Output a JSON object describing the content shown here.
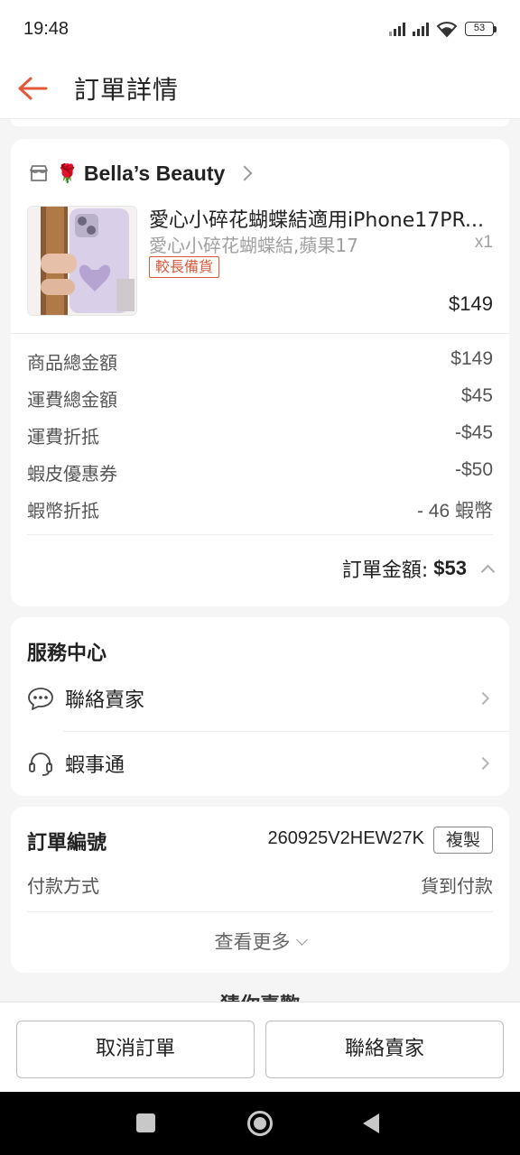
{
  "status_bar": {
    "time": "19:48",
    "battery": "53"
  },
  "header": {
    "title": "訂單詳情"
  },
  "shop": {
    "name": "Bella’s Beauty",
    "emoji": "🌹"
  },
  "product": {
    "title": "愛心小碎花蝴蝶結適用iPhone17PR...",
    "variant": "愛心小碎花蝴蝶結,蘋果17",
    "quantity": "x1",
    "tag": "較長備貨",
    "price": "$149"
  },
  "summary": {
    "rows": [
      {
        "label": "商品總金額",
        "value": "$149"
      },
      {
        "label": "運費總金額",
        "value": "$45"
      },
      {
        "label": "運費折抵",
        "value": "-$45"
      },
      {
        "label": "蝦皮優惠券",
        "value": "-$50"
      },
      {
        "label": "蝦幣折抵",
        "value": "- 46 蝦幣"
      }
    ],
    "total_label": "訂單金額:",
    "total_value": "$53"
  },
  "service": {
    "title": "服務中心",
    "items": [
      {
        "label": "聯絡賣家",
        "icon": "chat-icon"
      },
      {
        "label": "蝦事通",
        "icon": "headset-icon"
      }
    ]
  },
  "order_info": {
    "id_label": "訂單編號",
    "id_value": "260925V2HEW27K",
    "copy_label": "複製",
    "payment_label": "付款方式",
    "payment_value": "貨到付款",
    "more_label": "查看更多"
  },
  "recommend_label": "猜你喜歡",
  "bottom_bar": {
    "cancel_label": "取消訂單",
    "contact_label": "聯絡賣家"
  },
  "colors": {
    "accent": "#e05a3a",
    "tag": "#d85a3e",
    "background": "#f5f5f5"
  }
}
